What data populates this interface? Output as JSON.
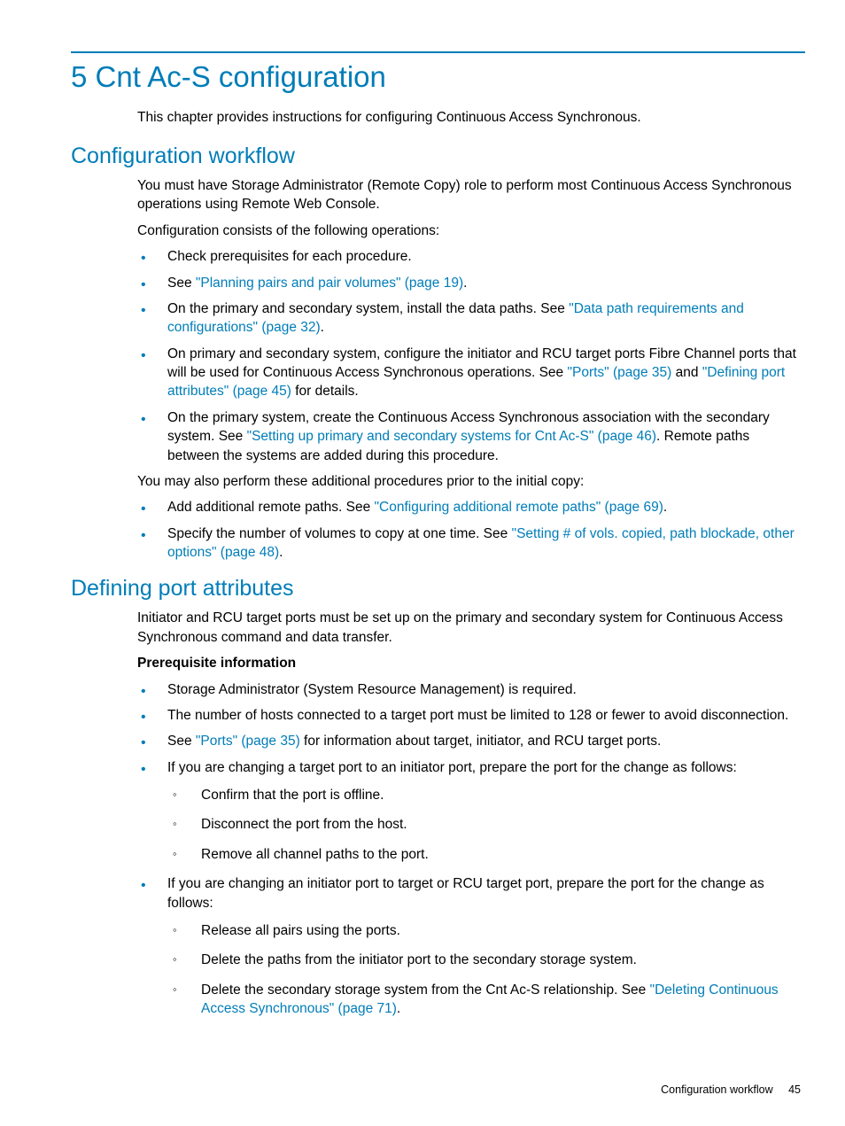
{
  "chapter_title": "5 Cnt Ac-S configuration",
  "intro": "This chapter provides instructions for configuring Continuous Access Synchronous.",
  "sec1": {
    "title": "Configuration workflow",
    "p1": "You must have Storage Administrator (Remote Copy) role to perform most Continuous Access Synchronous operations using Remote Web Console.",
    "p2": "Configuration consists of the following operations:",
    "li1": "Check prerequisites for each procedure.",
    "li2_a": "See ",
    "li2_link": "\"Planning pairs and pair volumes\" (page 19)",
    "li2_b": ".",
    "li3_a": "On the primary and secondary system, install the data paths. See ",
    "li3_link": "\"Data path requirements and configurations\" (page 32)",
    "li3_b": ".",
    "li4_a": "On primary and secondary system, configure the initiator and RCU target ports Fibre Channel ports that will be used for Continuous Access Synchronous operations. See ",
    "li4_link1": "\"Ports\" (page 35)",
    "li4_mid": " and ",
    "li4_link2": "\"Defining port attributes\" (page 45)",
    "li4_b": " for details.",
    "li5_a": "On the primary system, create the Continuous Access Synchronous association with the secondary system. See ",
    "li5_link": "\"Setting up primary and secondary systems for Cnt Ac-S\" (page 46)",
    "li5_b": ". Remote paths between the systems are added during this procedure.",
    "p3": "You may also perform these additional procedures prior to the initial copy:",
    "li6_a": "Add additional remote paths. See ",
    "li6_link": "\"Configuring additional remote paths\" (page 69)",
    "li6_b": ".",
    "li7_a": "Specify the number of volumes to copy at one time. See ",
    "li7_link": "\"Setting # of vols. copied, path blockade, other options\" (page 48)",
    "li7_b": "."
  },
  "sec2": {
    "title": "Defining port attributes",
    "p1": "Initiator and RCU target ports must be set up on the primary and secondary system for Continuous Access Synchronous command and data transfer.",
    "subhead": "Prerequisite information",
    "li1": "Storage Administrator (System Resource Management) is required.",
    "li2": "The number of hosts connected to a target port must be limited to 128 or fewer to avoid disconnection.",
    "li3_a": "See ",
    "li3_link": "\"Ports\" (page 35)",
    "li3_b": " for information about target, initiator, and RCU target ports.",
    "li4": "If you are changing a target port to an initiator port, prepare the port for the change as follows:",
    "li4_s1": "Confirm that the port is offline.",
    "li4_s2": "Disconnect the port from the host.",
    "li4_s3": "Remove all channel paths to the port.",
    "li5": "If you are changing an initiator port to target or RCU target port, prepare the port for the change as follows:",
    "li5_s1": "Release all pairs using the ports.",
    "li5_s2": "Delete the paths from the initiator port to the secondary storage system.",
    "li5_s3_a": "Delete the secondary storage system from the Cnt Ac-S relationship. See ",
    "li5_s3_link": "\"Deleting Continuous Access Synchronous\" (page 71)",
    "li5_s3_b": "."
  },
  "footer": {
    "section": "Configuration workflow",
    "page": "45"
  }
}
